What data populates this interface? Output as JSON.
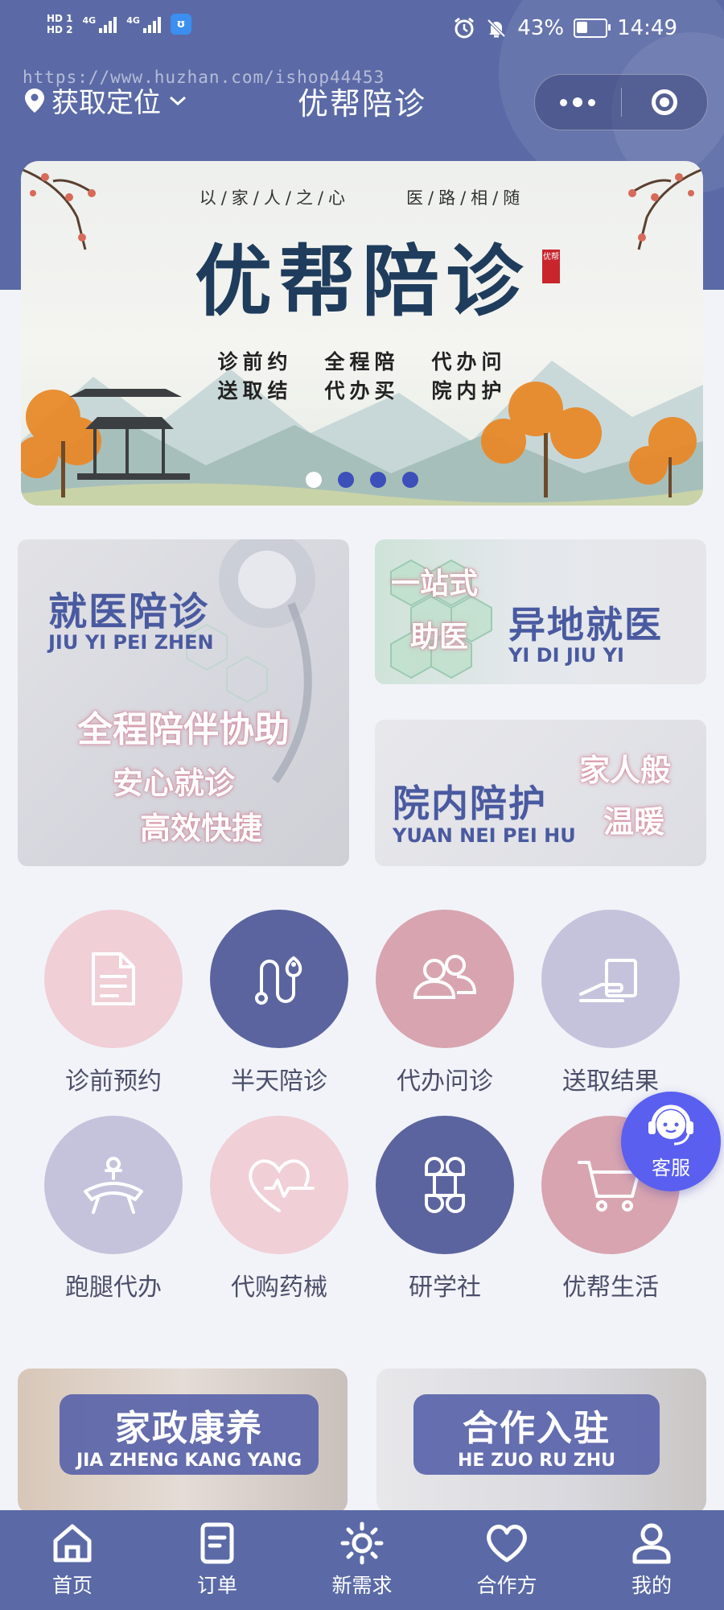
{
  "status_bar": {
    "hd1": "HD 1",
    "hd2": "HD 2",
    "net1": "4G",
    "net2": "4G",
    "battery": "43%",
    "battery_level": 0.43,
    "time": "14:49"
  },
  "watermark": "https://www.huzhan.com/ishop44453",
  "header": {
    "location_label": "获取定位",
    "title": "优帮陪诊"
  },
  "banner": {
    "motto_left": "以/家/人/之/心",
    "motto_right": "医/路/相/随",
    "title": "优帮陪诊",
    "seal": "优帮",
    "services": [
      [
        "诊前约",
        "送取结"
      ],
      [
        "全程陪",
        "代办买"
      ],
      [
        "代办问",
        "院内护"
      ]
    ],
    "active_dot": 0,
    "dot_count": 4
  },
  "cards": {
    "jiuyi": {
      "title": "就医陪诊",
      "pinyin": "JIU YI PEI ZHEN",
      "slogan": "全程陪伴协助",
      "line1": "安心就诊",
      "line2": "高效快捷"
    },
    "yidi": {
      "script1": "一站式",
      "script2": "助医",
      "title": "异地就医",
      "pinyin": "YI DI JIU YI"
    },
    "yuannei": {
      "title": "院内陪护",
      "pinyin": "YUAN NEI PEI HU",
      "script1": "家人般",
      "script2": "温暖"
    }
  },
  "grid": [
    {
      "label": "诊前预约",
      "icon": "document-icon",
      "color": "#f0cfd6"
    },
    {
      "label": "半天陪诊",
      "icon": "route-icon",
      "color": "#5b649e"
    },
    {
      "label": "代办问诊",
      "icon": "people-icon",
      "color": "#d8a4b0"
    },
    {
      "label": "送取结果",
      "icon": "hand-card-icon",
      "color": "#c5c3dc"
    },
    {
      "label": "跑腿代办",
      "icon": "runner-icon",
      "color": "#c5c3dc"
    },
    {
      "label": "代购药械",
      "icon": "heartbeat-icon",
      "color": "#f0cfd6"
    },
    {
      "label": "研学社",
      "icon": "command-icon",
      "color": "#5b649e"
    },
    {
      "label": "优帮生活",
      "icon": "cart-icon",
      "color": "#d8a4b0"
    }
  ],
  "kefu": {
    "label": "客服"
  },
  "bottom_cards": [
    {
      "title": "家政康养",
      "pinyin": "JIA ZHENG KANG YANG"
    },
    {
      "title": "合作入驻",
      "pinyin": "HE ZUO RU ZHU"
    }
  ],
  "tabbar": [
    {
      "label": "首页",
      "icon": "home-icon"
    },
    {
      "label": "订单",
      "icon": "order-icon"
    },
    {
      "label": "新需求",
      "icon": "sun-icon"
    },
    {
      "label": "合作方",
      "icon": "heart-icon"
    },
    {
      "label": "我的",
      "icon": "user-icon"
    }
  ]
}
